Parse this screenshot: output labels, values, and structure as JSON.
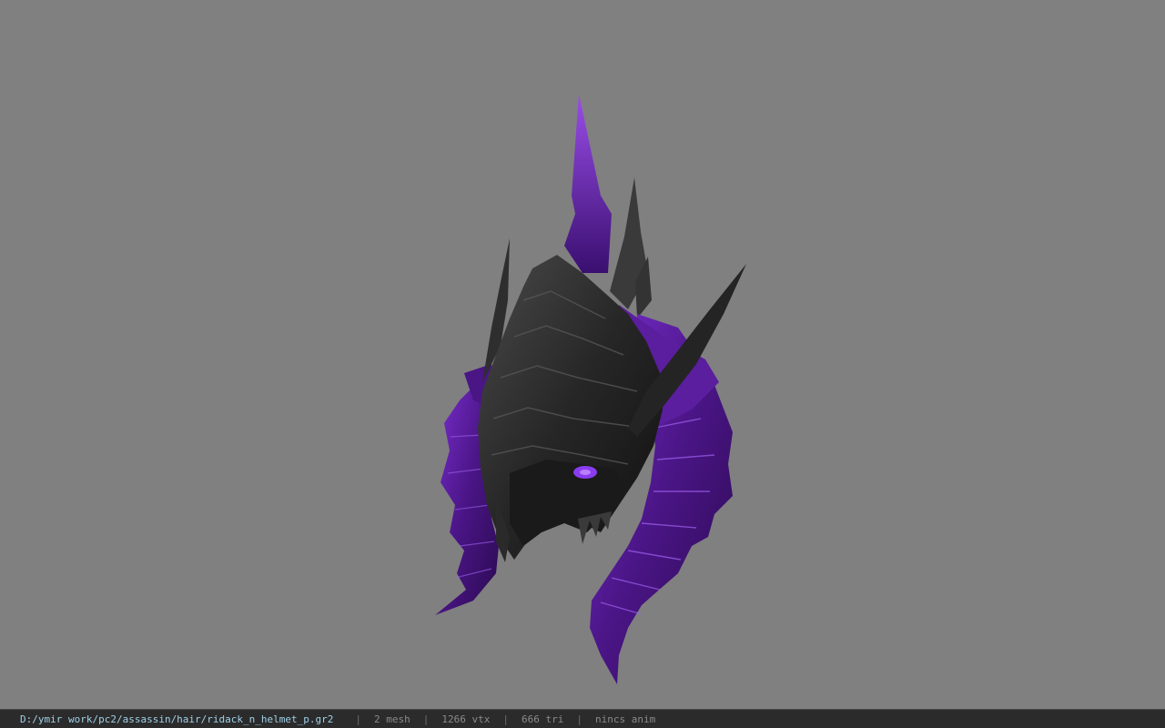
{
  "viewer": {
    "model_description": "purple and black spiked helmet model",
    "background_color": "#808080",
    "accent_purple": "#5a1e9e",
    "armor_black": "#2a2a2a"
  },
  "status_bar": {
    "file_path": "D:/ymir work/pc2/assassin/hair/ridack_n_helmet_p.gr2",
    "separator": "|",
    "mesh": "2 mesh",
    "vertices": "1266 vtx",
    "triangles": "666 tri",
    "animation": "nincs anim"
  }
}
